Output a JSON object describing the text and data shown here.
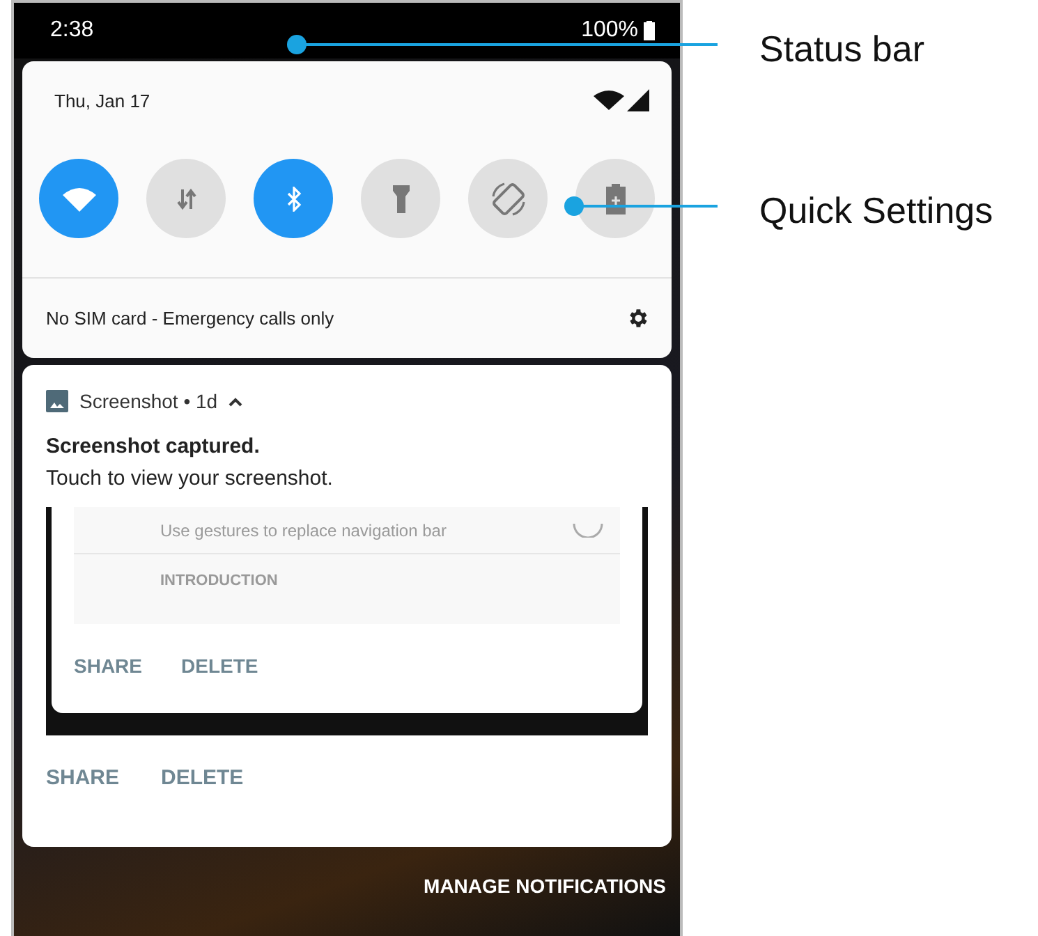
{
  "status_bar": {
    "time": "2:38",
    "battery": "100%"
  },
  "quick_settings": {
    "date": "Thu, Jan 17",
    "tiles": [
      {
        "kind": "wifi",
        "on": true
      },
      {
        "kind": "data",
        "on": false
      },
      {
        "kind": "bluetooth",
        "on": true
      },
      {
        "kind": "flashlight",
        "on": false
      },
      {
        "kind": "rotate",
        "on": false
      },
      {
        "kind": "battery",
        "on": false
      }
    ],
    "footer": "No SIM card - Emergency calls only"
  },
  "notification": {
    "app": "Screenshot",
    "separator": "•",
    "age": "1d",
    "title": "Screenshot captured.",
    "body": "Touch to view your screenshot.",
    "preview": {
      "row_text": "Use gestures to replace navigation bar",
      "section": "INTRODUCTION",
      "actions": [
        "SHARE",
        "DELETE"
      ]
    },
    "actions": [
      "SHARE",
      "DELETE"
    ]
  },
  "manage": "MANAGE NOTIFICATIONS",
  "callouts": [
    {
      "label": "Status bar"
    },
    {
      "label": "Quick Settings"
    }
  ]
}
